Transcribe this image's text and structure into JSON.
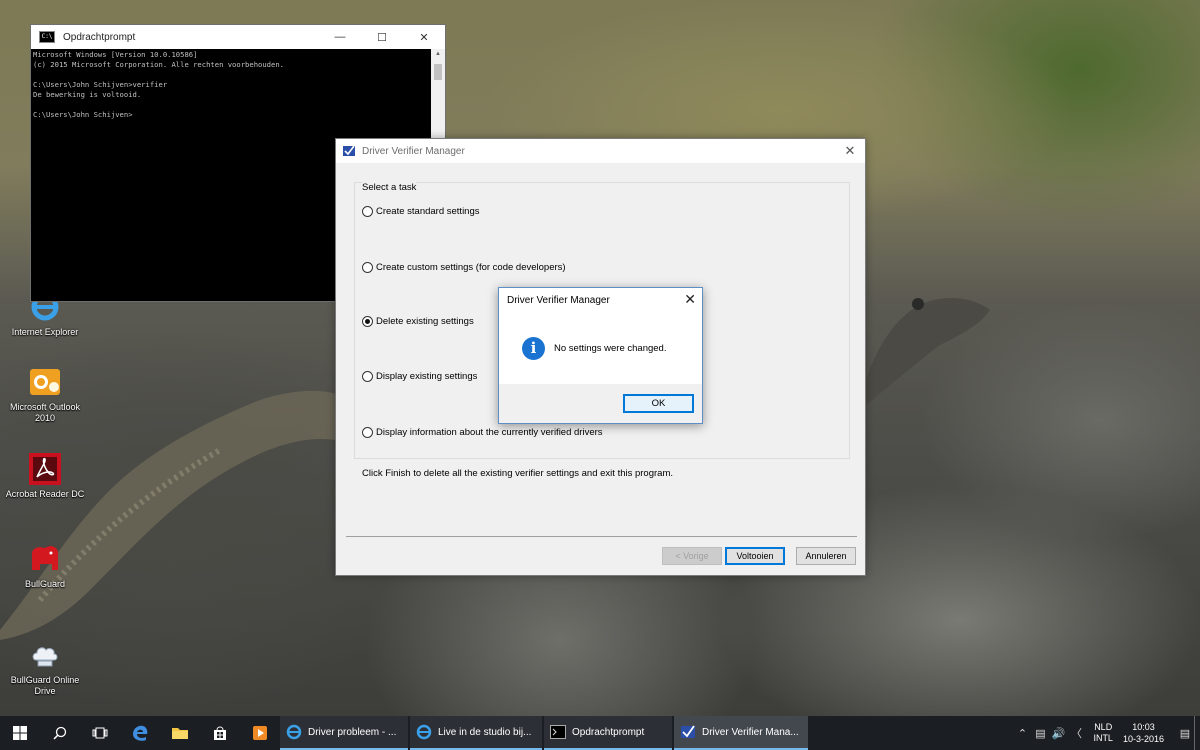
{
  "desktop": {
    "icons": [
      {
        "label": "Internet Explorer"
      },
      {
        "label": "Microsoft Outlook 2010"
      },
      {
        "label": "Acrobat Reader DC"
      },
      {
        "label": "BullGuard"
      },
      {
        "label": "BullGuard Online Drive"
      }
    ]
  },
  "cmd": {
    "title": "Opdrachtprompt",
    "lines": [
      "Microsoft Windows [Version 10.0.10586]",
      "(c) 2015 Microsoft Corporation. Alle rechten voorbehouden.",
      "",
      "C:\\Users\\John Schijven>verifier",
      "De bewerking is voltooid.",
      "",
      "C:\\Users\\John Schijven>"
    ]
  },
  "dvm": {
    "title": "Driver Verifier Manager",
    "group_label": "Select a task",
    "options": [
      {
        "label": "Create standard settings",
        "selected": false
      },
      {
        "label": "Create custom settings (for code developers)",
        "selected": false
      },
      {
        "label": "Delete existing settings",
        "selected": true
      },
      {
        "label": "Display existing settings",
        "selected": false
      },
      {
        "label": "Display information about the currently verified drivers",
        "selected": false
      }
    ],
    "hint": "Click Finish to delete all the existing verifier settings and exit this program.",
    "buttons": {
      "back": "< Vorige",
      "finish": "Voltooien",
      "cancel": "Annuleren"
    }
  },
  "message_box": {
    "title": "Driver Verifier Manager",
    "text": "No settings were changed.",
    "ok": "OK"
  },
  "taskbar": {
    "tasks": [
      {
        "label": "Driver probleem - ..."
      },
      {
        "label": "Live in de studio bij..."
      },
      {
        "label": "Opdrachtprompt"
      },
      {
        "label": "Driver Verifier Mana..."
      }
    ],
    "language_top": "NLD",
    "language_bottom": "INTL",
    "time": "10:03",
    "date": "10-3-2016"
  },
  "colors": {
    "accent": "#0078d7",
    "taskbar": "#1b1e22",
    "info_icon": "#1a73d0"
  }
}
